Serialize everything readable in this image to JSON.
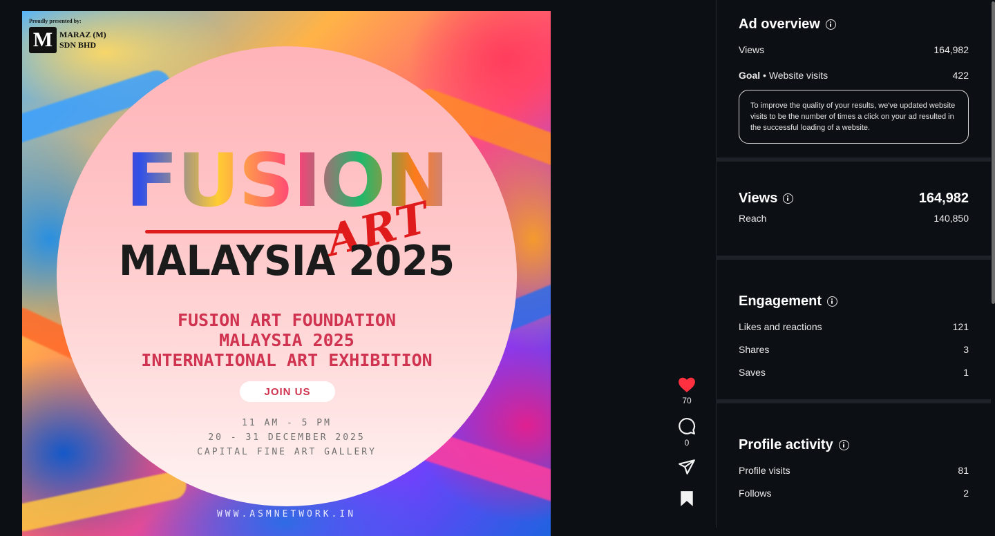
{
  "poster": {
    "presented_by": "Proudly presented by:",
    "logo_letter": "M",
    "company_line1": "MARAZ (M)",
    "company_line2": "SDN BHD",
    "headline": "FUSION",
    "script_word": "ART",
    "subheadline": "MALAYSIA 2025",
    "foundation_line1": "FUSION ART FOUNDATION",
    "foundation_line2": "MALAYSIA 2025",
    "foundation_line3": "INTERNATIONAL ART EXHIBITION",
    "cta": "JOIN US",
    "time": "11 AM - 5 PM",
    "dates": "20 - 31 DECEMBER 2025",
    "venue": "CAPITAL FINE ART GALLERY",
    "website": "WWW.ASMNETWORK.IN"
  },
  "actions": {
    "likes_count": "70",
    "comments_count": "0",
    "like_color": "#ff3040"
  },
  "ad_overview": {
    "title": "Ad overview",
    "views_label": "Views",
    "views_value": "164,982",
    "goal_label": "Goal",
    "goal_separator": " • ",
    "goal_name": "Website visits",
    "goal_value": "422",
    "note": "To improve the quality of your results, we've updated website visits to be the number of times a click on your ad resulted in the successful loading of a website."
  },
  "views": {
    "title": "Views",
    "value": "164,982",
    "reach_label": "Reach",
    "reach_value": "140,850"
  },
  "engagement": {
    "title": "Engagement",
    "likes_label": "Likes and reactions",
    "likes_value": "121",
    "shares_label": "Shares",
    "shares_value": "3",
    "saves_label": "Saves",
    "saves_value": "1"
  },
  "profile_activity": {
    "title": "Profile activity",
    "visits_label": "Profile visits",
    "visits_value": "81",
    "follows_label": "Follows",
    "follows_value": "2"
  }
}
